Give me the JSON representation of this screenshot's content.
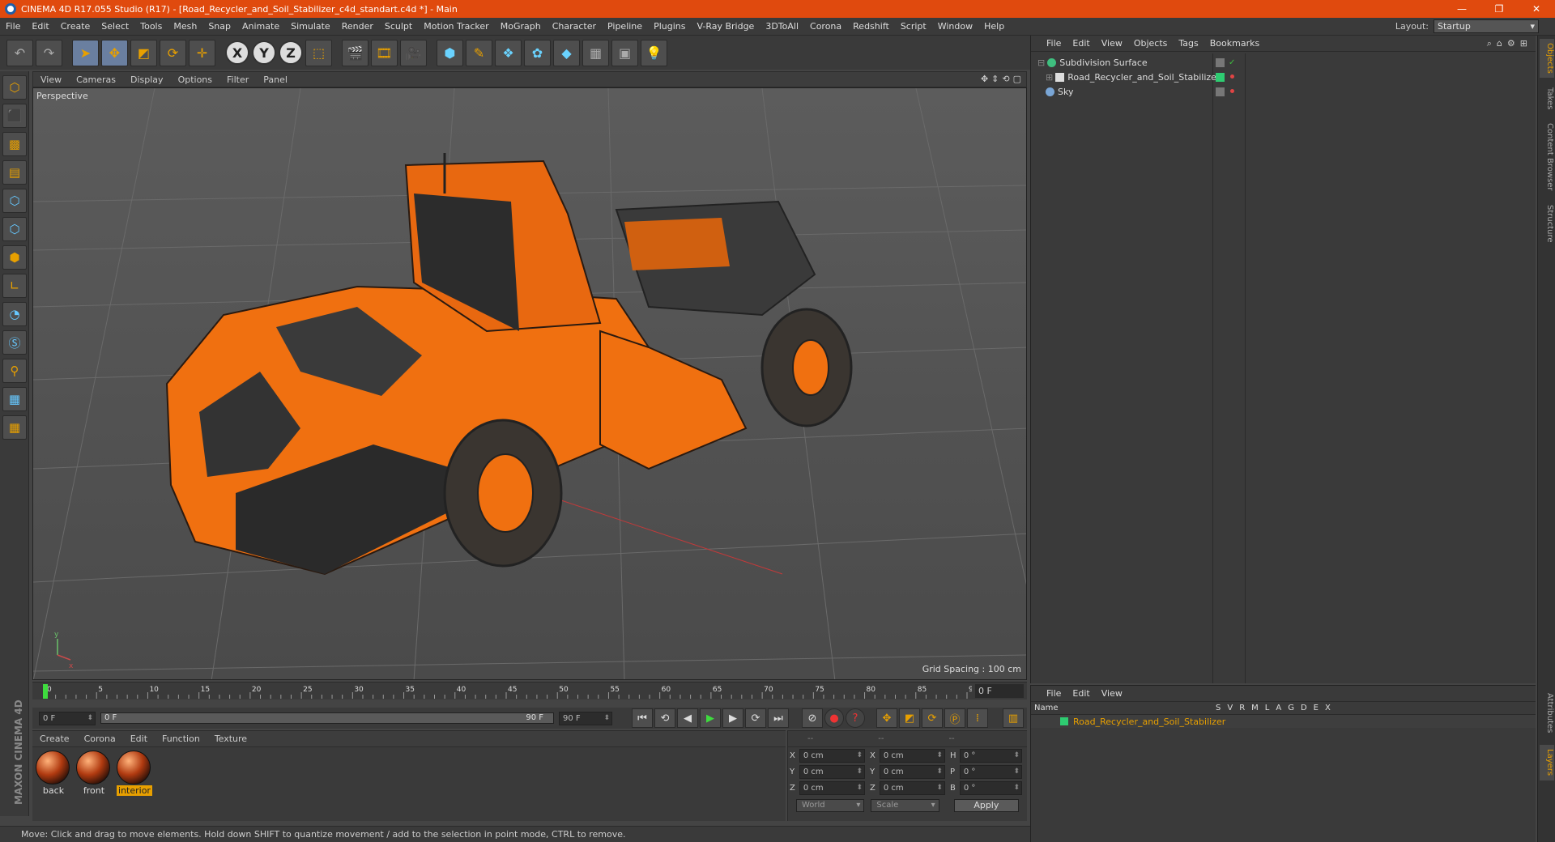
{
  "window": {
    "title": "CINEMA 4D R17.055 Studio (R17) - [Road_Recycler_and_Soil_Stabilizer_c4d_standart.c4d *] - Main",
    "controls": [
      "—",
      "❐",
      "✕"
    ]
  },
  "menubar": {
    "items": [
      "File",
      "Edit",
      "Create",
      "Select",
      "Tools",
      "Mesh",
      "Snap",
      "Animate",
      "Simulate",
      "Render",
      "Sculpt",
      "Motion Tracker",
      "MoGraph",
      "Character",
      "Pipeline",
      "Plugins",
      "V-Ray Bridge",
      "3DToAll",
      "Corona",
      "Redshift",
      "Script",
      "Window",
      "Help"
    ],
    "layout_label": "Layout:",
    "layout_value": "Startup"
  },
  "toolbar": {
    "axis_x": "X",
    "axis_y": "Y",
    "axis_z": "Z"
  },
  "viewport": {
    "menu": [
      "View",
      "Cameras",
      "Display",
      "Options",
      "Filter",
      "Panel"
    ],
    "label": "Perspective",
    "grid_spacing": "Grid Spacing : 100 cm",
    "axis_y": "y",
    "axis_x": "x"
  },
  "timeline": {
    "ticks": [
      "0",
      "5",
      "10",
      "15",
      "20",
      "25",
      "30",
      "35",
      "40",
      "45",
      "50",
      "55",
      "60",
      "65",
      "70",
      "75",
      "80",
      "85",
      "90"
    ],
    "current_frame": "0 F"
  },
  "playback": {
    "start": "0 F",
    "slider_start": "0 F",
    "slider_end": "90 F",
    "end": "90 F"
  },
  "materials": {
    "menu": [
      "Create",
      "Corona",
      "Edit",
      "Function",
      "Texture"
    ],
    "items": [
      {
        "label": "back",
        "selected": false
      },
      {
        "label": "front",
        "selected": false
      },
      {
        "label": "interior",
        "selected": true
      }
    ]
  },
  "coords": {
    "headers": [
      "--",
      "--",
      "--"
    ],
    "rows": [
      {
        "a": "X",
        "av": "0 cm",
        "b": "X",
        "bv": "0 cm",
        "c": "H",
        "cv": "0 °"
      },
      {
        "a": "Y",
        "av": "0 cm",
        "b": "Y",
        "bv": "0 cm",
        "c": "P",
        "cv": "0 °"
      },
      {
        "a": "Z",
        "av": "0 cm",
        "b": "Z",
        "bv": "0 cm",
        "c": "B",
        "cv": "0 °"
      }
    ],
    "world": "World",
    "scale": "Scale",
    "apply": "Apply"
  },
  "objects": {
    "menu": [
      "File",
      "Edit",
      "View",
      "Objects",
      "Tags",
      "Bookmarks"
    ],
    "items": [
      {
        "name": "Subdivision Surface",
        "icon_color": "#3fbf7f",
        "dot": "#3fbf3f"
      },
      {
        "name": "Road_Recycler_and_Soil_Stabilizer",
        "icon_color": "#3fbfa0",
        "dot": "#e04444"
      },
      {
        "name": "Sky",
        "icon_color": "#7aa6d6",
        "dot": "#e04444"
      }
    ]
  },
  "layers": {
    "menu": [
      "File",
      "Edit",
      "View"
    ],
    "name_header": "Name",
    "columns": [
      "S",
      "V",
      "R",
      "M",
      "L",
      "A",
      "G",
      "D",
      "E",
      "X"
    ],
    "row": "Road_Recycler_and_Soil_Stabilizer"
  },
  "right_tabs": [
    "Objects",
    "Takes",
    "Content Browser",
    "Structure",
    "Attributes",
    "Layers"
  ],
  "status": "Move: Click and drag to move elements. Hold down SHIFT to quantize movement / add to the selection in point mode, CTRL to remove.",
  "brand": "MAXON CINEMA 4D",
  "colors": {
    "accent": "#e04a0e",
    "highlight": "#e8a000",
    "machine_orange": "#f07010"
  }
}
